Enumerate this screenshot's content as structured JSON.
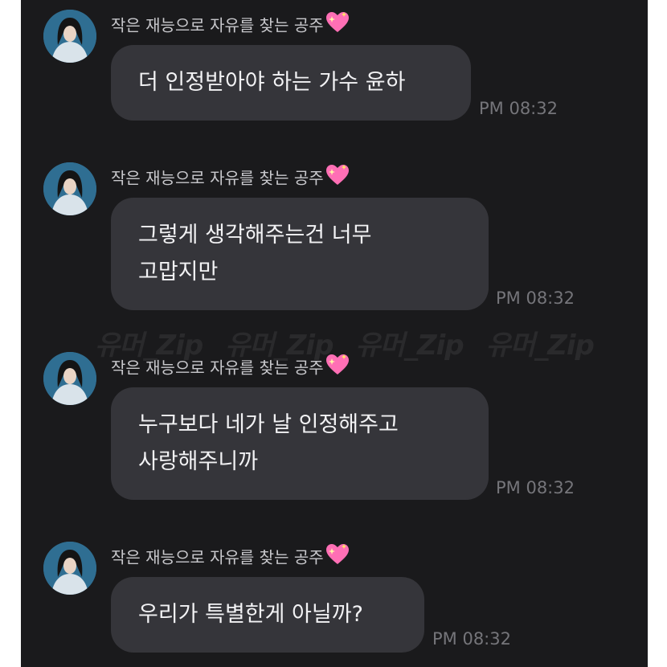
{
  "sender_name": "작은 재능으로 자유를 찾는 공주",
  "sender_emoji": "sparkling-heart",
  "watermark_text": "유머_Zip",
  "messages": [
    {
      "lines": [
        "더 인정받아야 하는 가수 윤하"
      ],
      "time": "PM 08:32"
    },
    {
      "lines": [
        "그렇게 생각해주는건 너무",
        "고맙지만"
      ],
      "time": "PM 08:32"
    },
    {
      "lines": [
        "누구보다 네가 날 인정해주고",
        "사랑해주니까"
      ],
      "time": "PM 08:32"
    },
    {
      "lines": [
        "우리가 특별한게 아닐까?"
      ],
      "time": "PM 08:32"
    }
  ],
  "colors": {
    "background": "#1a1a1c",
    "bubble": "#35353a",
    "text": "#f2f2f4",
    "sender": "#c8c8cc",
    "time": "#75757a",
    "heart": "#ff6fb5"
  }
}
